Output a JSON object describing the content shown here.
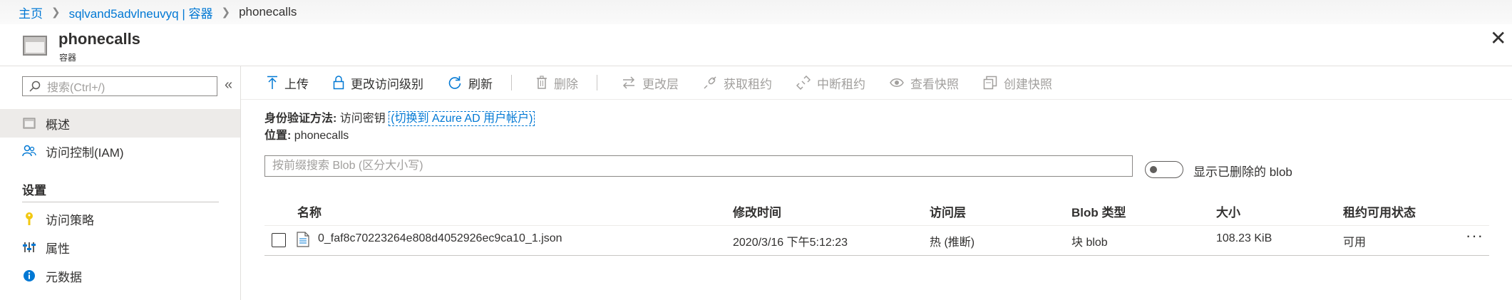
{
  "breadcrumb": {
    "home": "主页",
    "account": "sqlvand5advlneuvyq | 容器",
    "current": "phonecalls"
  },
  "header": {
    "title": "phonecalls",
    "subtitle": "容器"
  },
  "sidebar": {
    "search_placeholder": "搜索(Ctrl+/)",
    "items": [
      {
        "label": "概述",
        "icon": "overview-icon"
      },
      {
        "label": "访问控制(IAM)",
        "icon": "people-icon"
      }
    ],
    "section_title": "设置",
    "settings_items": [
      {
        "label": "访问策略",
        "icon": "key-icon"
      },
      {
        "label": "属性",
        "icon": "properties-icon"
      },
      {
        "label": "元数据",
        "icon": "info-icon"
      }
    ]
  },
  "toolbar": {
    "upload": "上传",
    "change_access": "更改访问级别",
    "refresh": "刷新",
    "delete": "删除",
    "change_tier": "更改层",
    "acquire_lease": "获取租约",
    "break_lease": "中断租约",
    "view_snapshot": "查看快照",
    "create_snapshot": "创建快照"
  },
  "auth": {
    "label": "身份验证方法:",
    "value": "访问密钥",
    "switch_link": "(切换到 Azure AD 用户帐户)"
  },
  "location": {
    "label": "位置:",
    "value": "phonecalls"
  },
  "blob_search": {
    "placeholder": "按前缀搜索 Blob (区分大小写)"
  },
  "show_deleted": "显示已删除的 blob",
  "table": {
    "columns": [
      "名称",
      "修改时间",
      "访问层",
      "Blob 类型",
      "大小",
      "租约可用状态"
    ],
    "rows": [
      {
        "name": "0_faf8c70223264e808d4052926ec9ca10_1.json",
        "modified": "2020/3/16 下午5:12:23",
        "tier": "热 (推断)",
        "type": "块 blob",
        "size": "108.23 KiB",
        "lease": "可用"
      }
    ]
  },
  "colors": {
    "link": "#0078d4",
    "disabled": "#a19f9d",
    "text": "#323130"
  }
}
